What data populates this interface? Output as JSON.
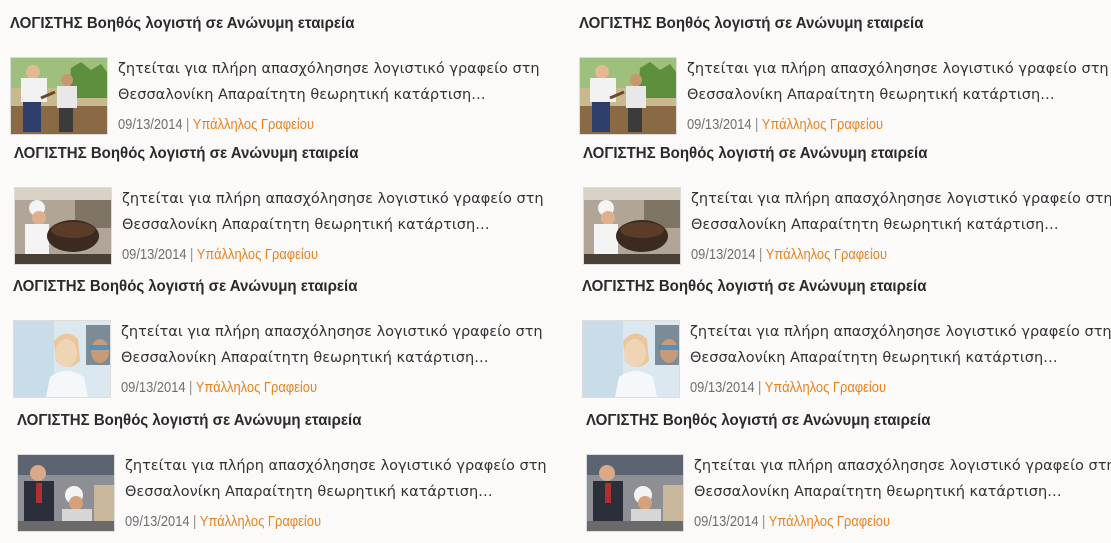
{
  "colors": {
    "background": "#fcf9f9",
    "title": "#2b2b2b",
    "text": "#333333",
    "date": "#6f6f6f",
    "category_accent": "#e6821e"
  },
  "listings": [
    {
      "title": "ΛΟΓΙΣΤΗΣ Βοηθός λογιστή σε Ανώνυμη εταιρεία",
      "excerpt_line1": "ζητείται για πλήρη απασχόλησησε λογιστικό γραφείο στη",
      "excerpt_line2": "Θεσσαλονίκη Απαραίτητη θεωρητική κατάρτιση…",
      "date": "09/13/2014",
      "separator": "|",
      "category": "Υπάλληλος Γραφείου",
      "image": "gardening-photo"
    },
    {
      "title": "ΛΟΓΙΣΤΗΣ Βοηθός λογιστή σε Ανώνυμη εταιρεία",
      "excerpt_line1": "ζητείται για πλήρη απασχόλησησε λογιστικό γραφείο στη",
      "excerpt_line2": "Θεσσαλονίκη Απαραίτητη θεωρητική κατάρτιση…",
      "date": "09/13/2014",
      "separator": "|",
      "category": "Υπάλληλος Γραφείου",
      "image": "gardening-photo"
    },
    {
      "title": "ΛΟΓΙΣΤΗΣ Βοηθός λογιστή σε Ανώνυμη εταιρεία",
      "excerpt_line1": "ζητείται για πλήρη απασχόλησησε λογιστικό γραφείο στη",
      "excerpt_line2": "Θεσσαλονίκη Απαραίτητη θεωρητική κατάρτιση…",
      "date": "09/13/2014",
      "separator": "|",
      "category": "Υπάλληλος Γραφείου",
      "image": "chef-kitchen-photo"
    },
    {
      "title": "ΛΟΓΙΣΤΗΣ Βοηθός λογιστή σε Ανώνυμη εταιρεία",
      "excerpt_line1": "ζητείται για πλήρη απασχόλησησε λογιστικό γραφείο στη",
      "excerpt_line2": "Θεσσαλονίκη Απαραίτητη θεωρητική κατάρτιση…",
      "date": "09/13/2014",
      "separator": "|",
      "category": "Υπάλληλος Γραφείου",
      "image": "chef-kitchen-photo"
    },
    {
      "title": "ΛΟΓΙΣΤΗΣ Βοηθός λογιστή σε Ανώνυμη εταιρεία",
      "excerpt_line1": "ζητείται για πλήρη απασχόλησησε λογιστικό γραφείο στη",
      "excerpt_line2": "Θεσσαλονίκη Απαραίτητη θεωρητική κατάρτιση…",
      "date": "09/13/2014",
      "separator": "|",
      "category": "Υπάλληλος Γραφείου",
      "image": "laboratory-photo"
    },
    {
      "title": "ΛΟΓΙΣΤΗΣ Βοηθός λογιστή σε Ανώνυμη εταιρεία",
      "excerpt_line1": "ζητείται για πλήρη απασχόλησησε λογιστικό γραφείο στη",
      "excerpt_line2": "Θεσσαλονίκη Απαραίτητη θεωρητική κατάρτιση…",
      "date": "09/13/2014",
      "separator": "|",
      "category": "Υπάλληλος Γραφείου",
      "image": "laboratory-photo"
    },
    {
      "title": "ΛΟΓΙΣΤΗΣ Βοηθός λογιστή σε Ανώνυμη εταιρεία",
      "excerpt_line1": "ζητείται για πλήρη απασχόλησησε λογιστικό γραφείο στη",
      "excerpt_line2": "Θεσσαλονίκη Απαραίτητη θεωρητική κατάρτιση…",
      "date": "09/13/2014",
      "separator": "|",
      "category": "Υπάλληλος Γραφείου",
      "image": "workers-photo"
    },
    {
      "title": "ΛΟΓΙΣΤΗΣ Βοηθός λογιστή σε Ανώνυμη εταιρεία",
      "excerpt_line1": "ζητείται για πλήρη απασχόλησησε λογιστικό γραφείο στη",
      "excerpt_line2": "Θεσσαλονίκη Απαραίτητη θεωρητική κατάρτιση…",
      "date": "09/13/2014",
      "separator": "|",
      "category": "Υπάλληλος Γραφείου",
      "image": "workers-photo"
    }
  ]
}
